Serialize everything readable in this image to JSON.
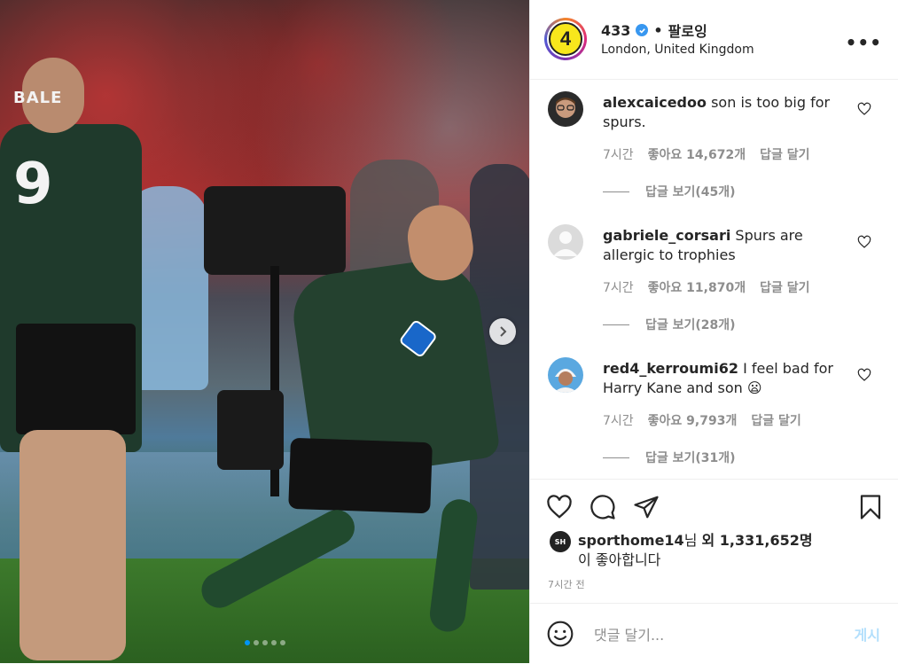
{
  "post": {
    "slide_count": 5,
    "active_slide": 1,
    "jersey_name": "BALE",
    "jersey_number": "9"
  },
  "header": {
    "username": "433",
    "follow_separator": "•",
    "follow_label": "팔로잉",
    "location": "London, United Kingdom",
    "more_label": "•••",
    "avatar_text": "4"
  },
  "comments": [
    {
      "username": "alexcaicedoo",
      "text": "son is too big for spurs.",
      "time": "7시간",
      "likes": "좋아요 14,672개",
      "reply": "답글 달기",
      "view_replies": "답글 보기(45개)"
    },
    {
      "username": "gabriele_corsari",
      "text": "Spurs are allergic to trophies",
      "time": "7시간",
      "likes": "좋아요 11,870개",
      "reply": "답글 달기",
      "view_replies": "답글 보기(28개)"
    },
    {
      "username": "red4_kerroumi62",
      "text": "I feel bad for Harry Kane and son 😦",
      "time": "7시간",
      "likes": "좋아요 9,793개",
      "reply": "답글 달기",
      "view_replies": "답글 보기(31개)"
    }
  ],
  "likes_summary": {
    "liker": "sporthome14",
    "suffix1": "님 ",
    "others": "외 1,331,652명",
    "line2": "이 좋아합니다",
    "avatar_text": "SH"
  },
  "timestamp": "7시간 전",
  "comment_input": {
    "placeholder": "댓글 달기...",
    "post_label": "게시"
  },
  "colors": {
    "verified": "#3897f0",
    "active_dot": "#0095f6",
    "post_disabled": "#b2dffc",
    "meta_gray": "#8e8e8e"
  }
}
